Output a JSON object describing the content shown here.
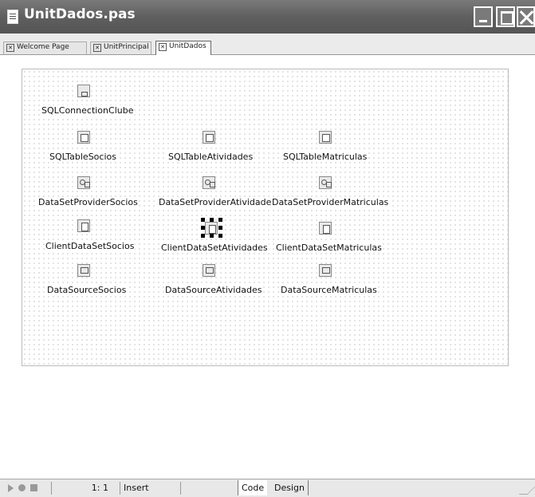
{
  "window": {
    "title": "UnitDados.pas"
  },
  "tabs": [
    {
      "label": "Welcome Page",
      "active": false
    },
    {
      "label": "UnitPrincipal",
      "active": false
    },
    {
      "label": "UnitDados",
      "active": true
    }
  ],
  "components": [
    {
      "label": "SQLConnectionClube",
      "icon": "sql-connection-icon"
    },
    {
      "label": "SQLTableSocios",
      "icon": "sql-table-icon"
    },
    {
      "label": "SQLTableAtividades",
      "icon": "sql-table-icon"
    },
    {
      "label": "SQLTableMatriculas",
      "icon": "sql-table-icon"
    },
    {
      "label": "DataSetProviderSocios",
      "icon": "dataset-provider-icon"
    },
    {
      "label": "DataSetProviderAtividades",
      "icon": "dataset-provider-icon"
    },
    {
      "label": "DataSetProviderMatriculas",
      "icon": "dataset-provider-icon"
    },
    {
      "label": "ClientDataSetSocios",
      "icon": "client-dataset-icon"
    },
    {
      "label": "ClientDataSetAtividades",
      "icon": "client-dataset-icon",
      "selected": true
    },
    {
      "label": "ClientDataSetMatriculas",
      "icon": "client-dataset-icon"
    },
    {
      "label": "DataSourceSocios",
      "icon": "datasource-icon"
    },
    {
      "label": "DataSourceAtividades",
      "icon": "datasource-icon"
    },
    {
      "label": "DataSourceMatriculas",
      "icon": "datasource-icon"
    }
  ],
  "statusbar": {
    "position": "1:   1",
    "mode": "Insert",
    "code_tab": "Code",
    "design_tab": "Design"
  }
}
